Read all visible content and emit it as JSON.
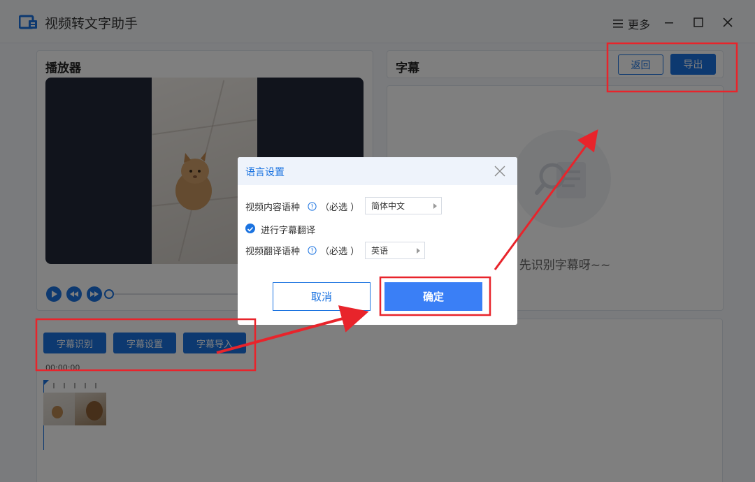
{
  "app": {
    "title": "视频转文字助手",
    "more_label": "更多"
  },
  "player": {
    "title": "播放器"
  },
  "subtitle_panel": {
    "title": "字幕",
    "back_label": "返回",
    "export_label": "导出",
    "empty_text": "先识别字幕呀~~"
  },
  "toolbar": {
    "buttons": [
      "字幕识别",
      "字幕设置",
      "字幕导入"
    ],
    "timecode": "00:00:00"
  },
  "dialog": {
    "title": "语言设置",
    "content_lang_label": "视频内容语种",
    "required_text": "（必选 ）",
    "content_lang_value": "简体中文",
    "translate_label": "进行字幕翻译",
    "translate_checked": true,
    "translate_lang_label": "视频翻译语种",
    "translate_lang_value": "英语",
    "cancel_label": "取消",
    "ok_label": "确定"
  },
  "colors": {
    "accent": "#1b73e0",
    "highlight": "#e8242b"
  }
}
